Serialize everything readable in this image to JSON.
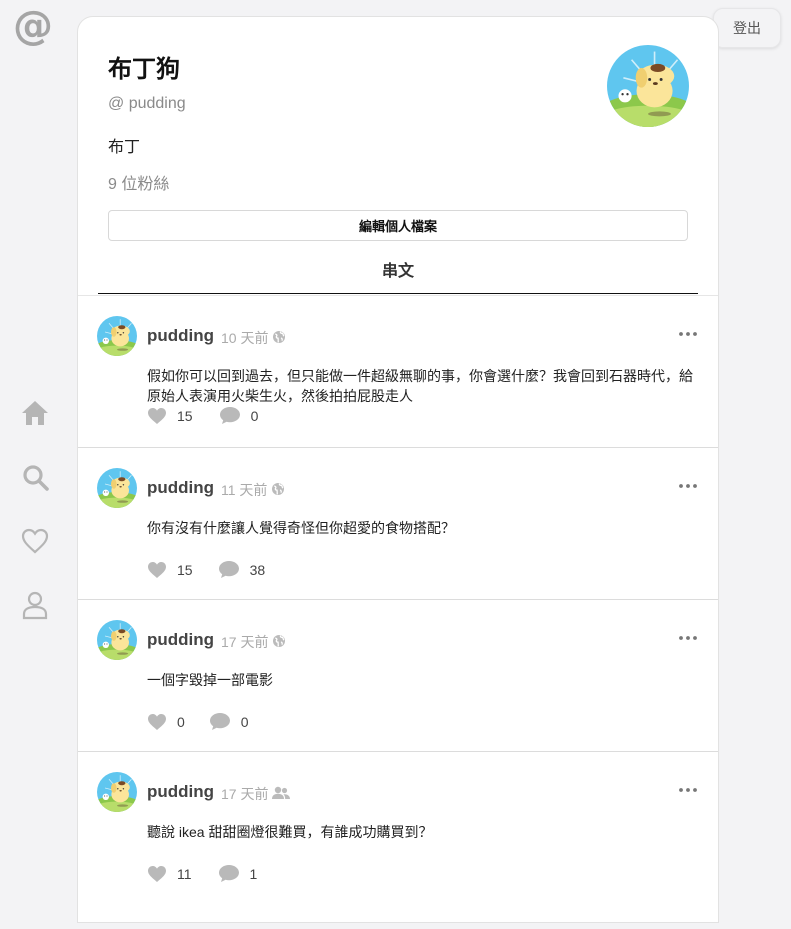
{
  "header": {
    "logout_label": "登出"
  },
  "sidebar": {
    "items": [
      {
        "icon": "home-icon"
      },
      {
        "icon": "search-icon"
      },
      {
        "icon": "heart-icon"
      },
      {
        "icon": "user-icon"
      }
    ]
  },
  "profile": {
    "name": "布丁狗",
    "handle": "@ pudding",
    "bio": "布丁",
    "followers": "9 位粉絲",
    "edit_label": "編輯個人檔案",
    "tab_label": "串文"
  },
  "posts": [
    {
      "username": "pudding",
      "time": "10 天前",
      "visibility": "globe-icon",
      "text": "假如你可以回到過去，但只能做一件超級無聊的事，你會選什麼？我會回到石器時代，給原始人表演用火柴生火，然後拍拍屁股走人",
      "likes": "15",
      "comments": "0"
    },
    {
      "username": "pudding",
      "time": "11 天前",
      "visibility": "globe-icon",
      "text": "你有沒有什麼讓人覺得奇怪但你超愛的食物搭配？",
      "likes": "15",
      "comments": "38"
    },
    {
      "username": "pudding",
      "time": "17 天前",
      "visibility": "globe-icon",
      "text": "一個字毀掉一部電影",
      "likes": "0",
      "comments": "0"
    },
    {
      "username": "pudding",
      "time": "17 天前",
      "visibility": "friends-icon",
      "text": "聽說 ikea 甜甜圈燈很難買，有誰成功購買到？",
      "likes": "11",
      "comments": "1"
    }
  ],
  "colors": {
    "background": "#f3f3f5",
    "icon_gray": "#b5b5b5",
    "text_muted": "#8a8a8a"
  }
}
